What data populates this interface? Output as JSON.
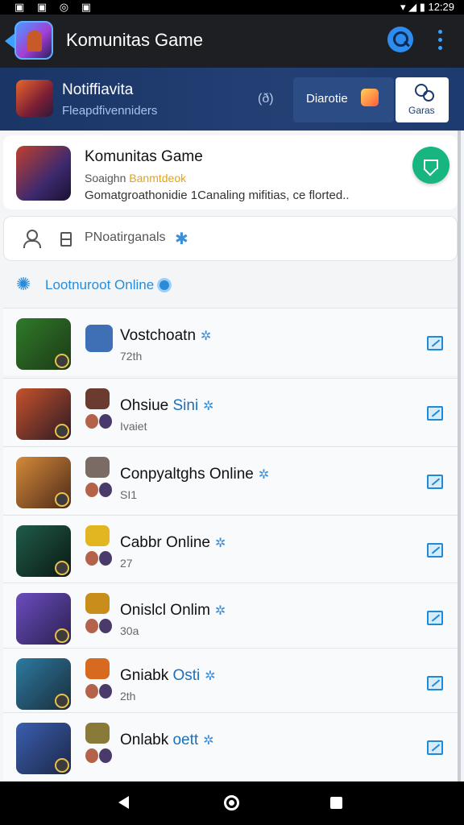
{
  "appbar": {
    "title": "Komunitas Game"
  },
  "notification": {
    "title": "Notiffiavita",
    "subtitle": "Fleapdfivenniders",
    "badge": "(ð)",
    "action_label": "Diarotie",
    "games_label": "Garas"
  },
  "game_card": {
    "title": "Komunitas Game",
    "meta_prefix": "Soaighn",
    "meta_highlight": "Banmtdeok",
    "description": "Gomatgroathonidie 1Canaling mifitias, ce florted.."
  },
  "search": {
    "placeholder": "PNoatirganals"
  },
  "section": {
    "title": "Lootnuroot Online"
  },
  "games": [
    {
      "name": "Vostchoatn",
      "accent": "",
      "sub": "72th",
      "colors": [
        "#2f7a2a",
        "#1c3a16"
      ],
      "avatar": "#3f6fb4"
    },
    {
      "name": "Ohsiue ",
      "accent": "Sini",
      "sub": "Ivaiet",
      "colors": [
        "#c5522c",
        "#2d1a24"
      ],
      "avatar": "#6a3b2e"
    },
    {
      "name": "Conpyaltghs Online",
      "accent": "",
      "sub": "SI1",
      "colors": [
        "#d58a3a",
        "#4d2a18"
      ],
      "avatar": "#7a6b64"
    },
    {
      "name": "Cabbr Online",
      "accent": "",
      "sub": "27",
      "colors": [
        "#1f5c49",
        "#0b1914"
      ],
      "avatar": "#e2b620"
    },
    {
      "name": "Onislcl Onlim",
      "accent": "",
      "sub": "30a",
      "colors": [
        "#6a4dbf",
        "#2c2050"
      ],
      "avatar": "#c98d1c"
    },
    {
      "name": "Gniabk ",
      "accent": "Osti",
      "sub": "2th",
      "colors": [
        "#2d7aa0",
        "#1a2d3c"
      ],
      "avatar": "#d86a1f"
    },
    {
      "name": "Onlabk ",
      "accent": "oett",
      "sub": "",
      "colors": [
        "#3a5fb0",
        "#1d2748"
      ],
      "avatar": "#8a7a3a"
    }
  ]
}
